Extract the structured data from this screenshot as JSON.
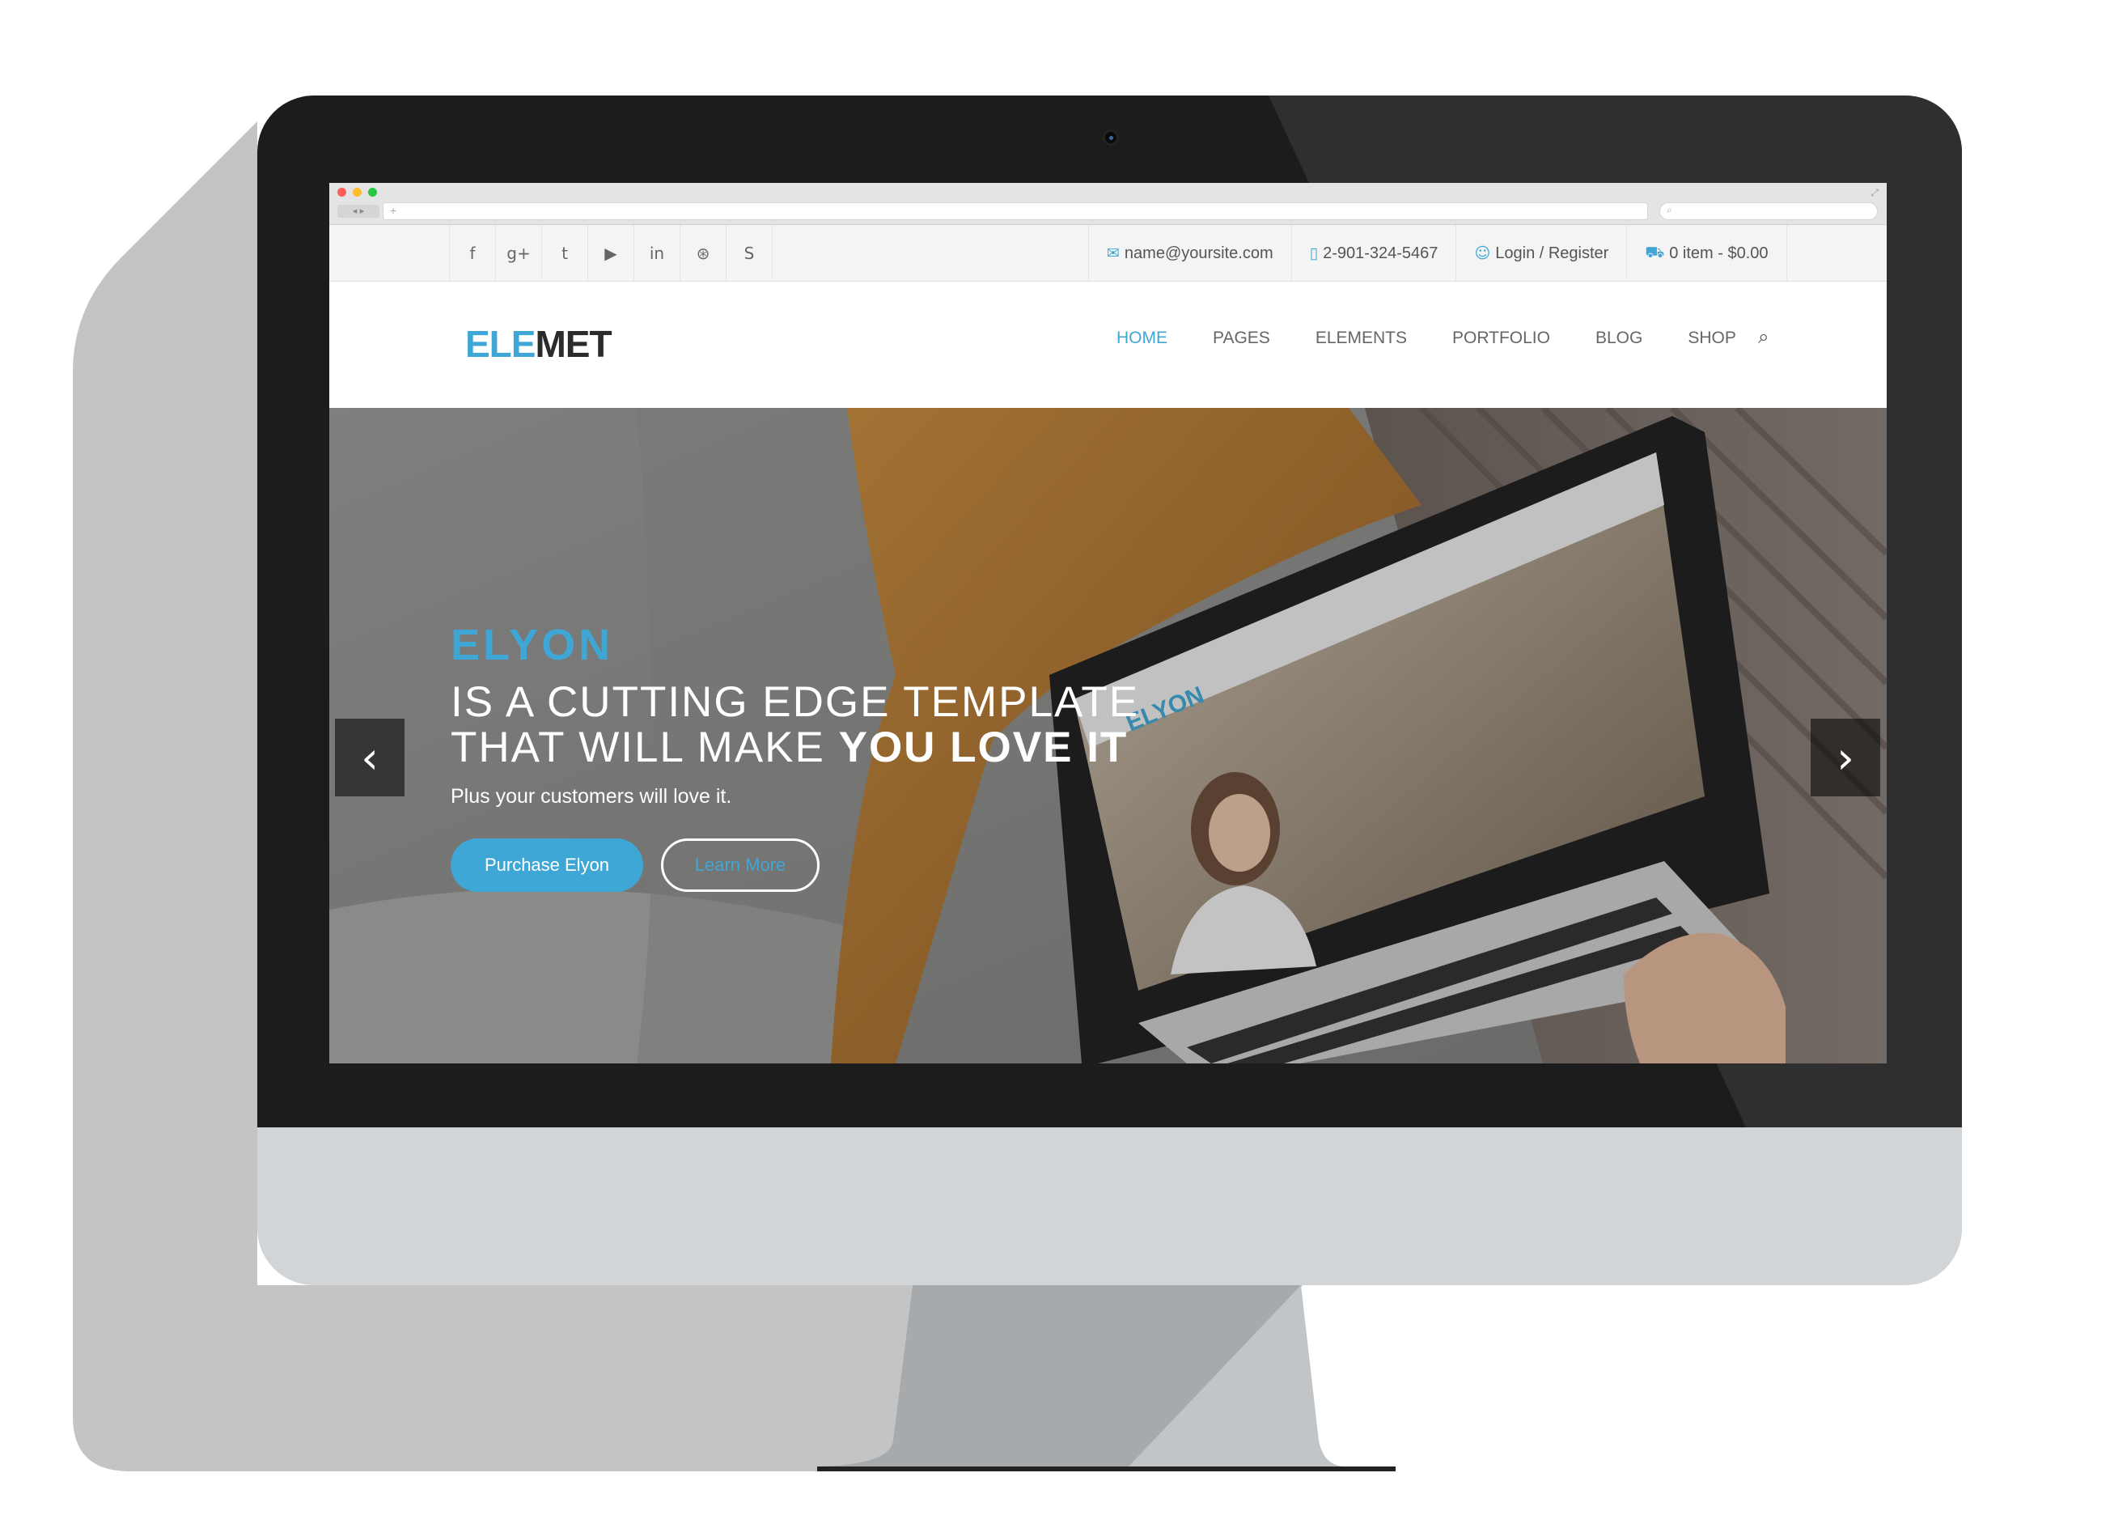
{
  "colors": {
    "accent": "#3fa7d6",
    "bezel": "#1c1c1c",
    "chin": "#d2d5d8",
    "shadow": "#c4c4c4",
    "topbar_bg": "#f4f4f4"
  },
  "browser": {
    "traffic_lights": [
      "#fc5f57",
      "#fdbd2e",
      "#28c840"
    ]
  },
  "topbar": {
    "social_icons": [
      "facebook-icon",
      "google-plus-icon",
      "twitter-icon",
      "youtube-icon",
      "linkedin-icon",
      "dribbble-icon",
      "skype-icon"
    ],
    "social_glyphs": [
      "f",
      "g+",
      "t",
      "▶",
      "in",
      "⊛",
      "S"
    ],
    "email": "name@yoursite.com",
    "phone": "2-901-324-5467",
    "login": "Login / Register",
    "cart": "0 item - $0.00"
  },
  "header": {
    "logo_part1": "ELE",
    "logo_part2": "MET",
    "menu": [
      "HOME",
      "PAGES",
      "ELEMENTS",
      "PORTFOLIO",
      "BLOG",
      "SHOP"
    ],
    "active_menu": "HOME"
  },
  "hero": {
    "eyebrow": "ELYON",
    "headline_line1": "IS A CUTTING EDGE TEMPLATE",
    "headline_line2_normal": "THAT WILL MAKE ",
    "headline_line2_bold": "YOU LOVE IT",
    "subtitle": "Plus your customers will love it.",
    "primary_button": "Purchase Elyon",
    "secondary_button": "Learn More",
    "arrow_left": "‹",
    "arrow_right": "›"
  }
}
